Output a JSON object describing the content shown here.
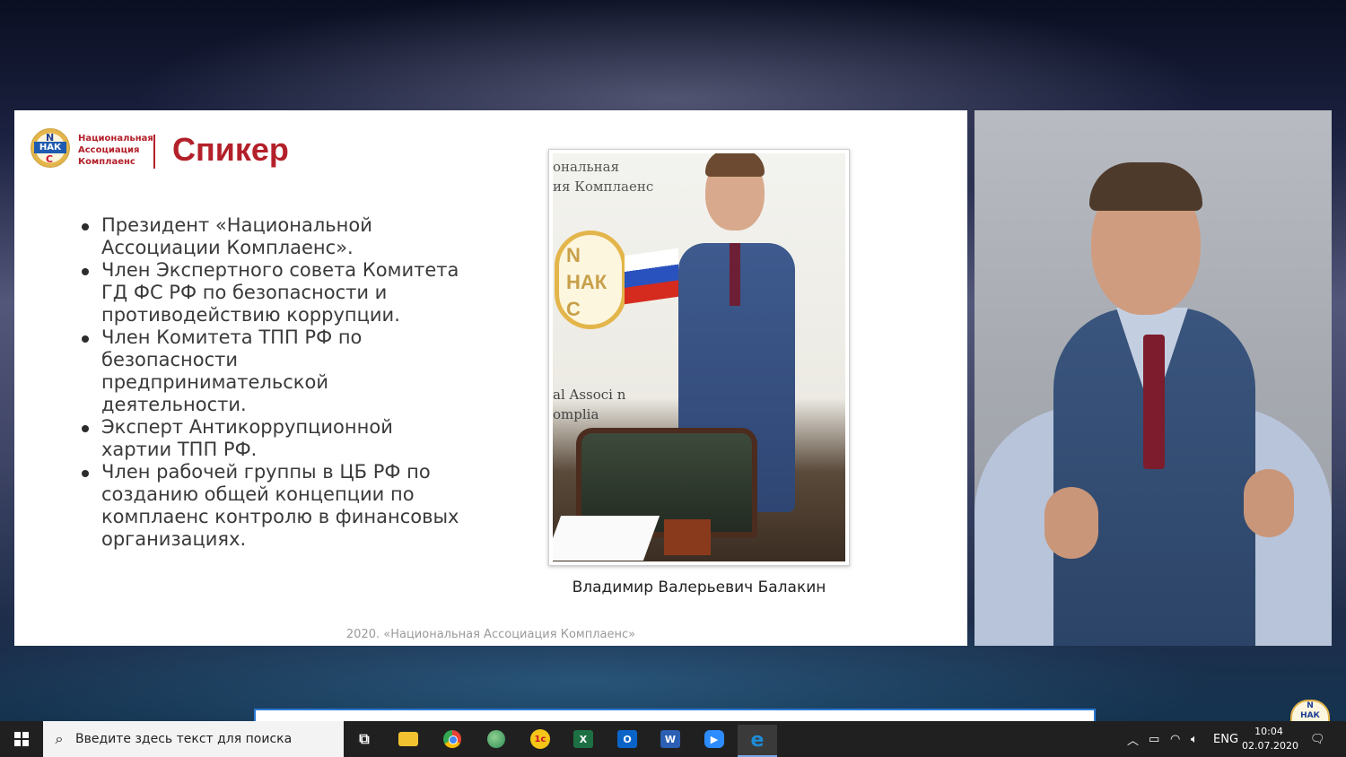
{
  "slide": {
    "logo_letters": {
      "top": "N",
      "middle": "НАК",
      "bottom": "С"
    },
    "logo_text": [
      "Национальная",
      "Ассоциация",
      "Комплаенс"
    ],
    "title": "Спикер",
    "bullets": [
      "Президент «Национальной Ассоциации Комплаенс».",
      "Член Экспертного совета Комитета ГД ФС РФ по безопасности и противодействию коррупции.",
      "Член Комитета ТПП РФ по безопасности предпринимательской деятельности.",
      "Эксперт Антикоррупционной хартии ТПП РФ.",
      "Член рабочей группы в ЦБ РФ по созданию общей концепции по комплаенс контролю в финансовых организациях."
    ],
    "photo_banner_top": [
      "ональная",
      "ия Комплаенс"
    ],
    "photo_banner_bottom": [
      "al Associ   n",
      "omplia"
    ],
    "photo_badge": [
      "N",
      "НАК",
      "С"
    ],
    "caption": "Владимир Валерьевич Балакин",
    "footer": "2020. «Национальная Ассоциация Комплаенс»"
  },
  "video_logo": {
    "top": "N",
    "bottom": "НАК"
  },
  "taskbar": {
    "search_placeholder": "Введите здесь текст для поиска",
    "apps": [
      {
        "name": "task-view",
        "glyph": "⧉",
        "color": "#202020"
      },
      {
        "name": "file-explorer",
        "glyph": "",
        "color": "#f2c230"
      },
      {
        "name": "chrome",
        "glyph": "",
        "color": "#34a853"
      },
      {
        "name": "browser-globe",
        "glyph": "",
        "color": "#2e8b57"
      },
      {
        "name": "1c",
        "glyph": "1с",
        "color": "#f5c518"
      },
      {
        "name": "excel",
        "glyph": "X",
        "color": "#1d7044"
      },
      {
        "name": "outlook",
        "glyph": "O",
        "color": "#0a64c8"
      },
      {
        "name": "word",
        "glyph": "W",
        "color": "#2b5fb4"
      },
      {
        "name": "zoom",
        "glyph": "▶",
        "color": "#2d8cff"
      },
      {
        "name": "edge",
        "glyph": "e",
        "color": "#1e8bd6"
      }
    ],
    "language": "ENG",
    "time": "10:04",
    "date": "02.07.2020"
  }
}
